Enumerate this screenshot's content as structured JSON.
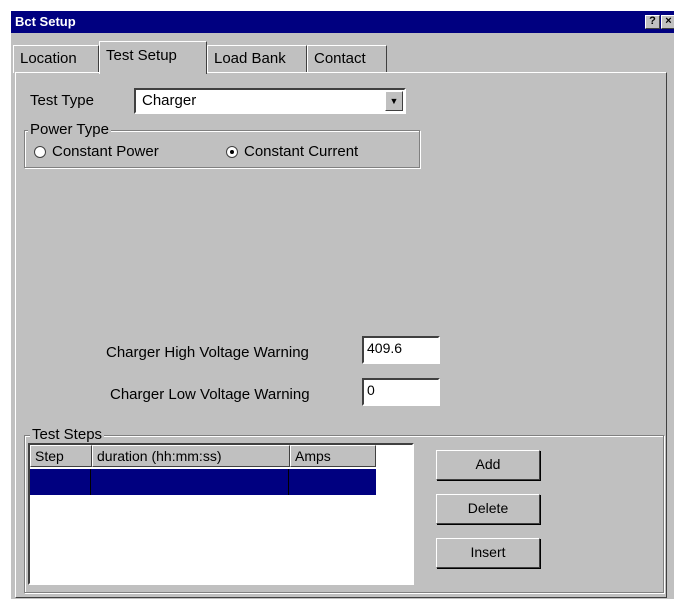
{
  "window": {
    "title": "Bct Setup",
    "help_glyph": "?",
    "close_glyph": "×"
  },
  "tabs": [
    {
      "label": "Location"
    },
    {
      "label": "Test Setup"
    },
    {
      "label": "Load Bank"
    },
    {
      "label": "Contact"
    }
  ],
  "test_type": {
    "label": "Test Type",
    "value": "Charger"
  },
  "power_type": {
    "legend": "Power Type",
    "options": [
      {
        "label": "Constant Power",
        "selected": false
      },
      {
        "label": "Constant Current",
        "selected": true
      }
    ]
  },
  "high_voltage": {
    "label": "Charger High Voltage Warning",
    "value": "409.6"
  },
  "low_voltage": {
    "label": "Charger Low Voltage Warning",
    "value": "0"
  },
  "test_steps": {
    "legend": "Test Steps",
    "columns": [
      "Step",
      "duration (hh:mm:ss)",
      "Amps"
    ]
  },
  "buttons": {
    "add": "Add",
    "delete": "Delete",
    "insert": "Insert"
  }
}
